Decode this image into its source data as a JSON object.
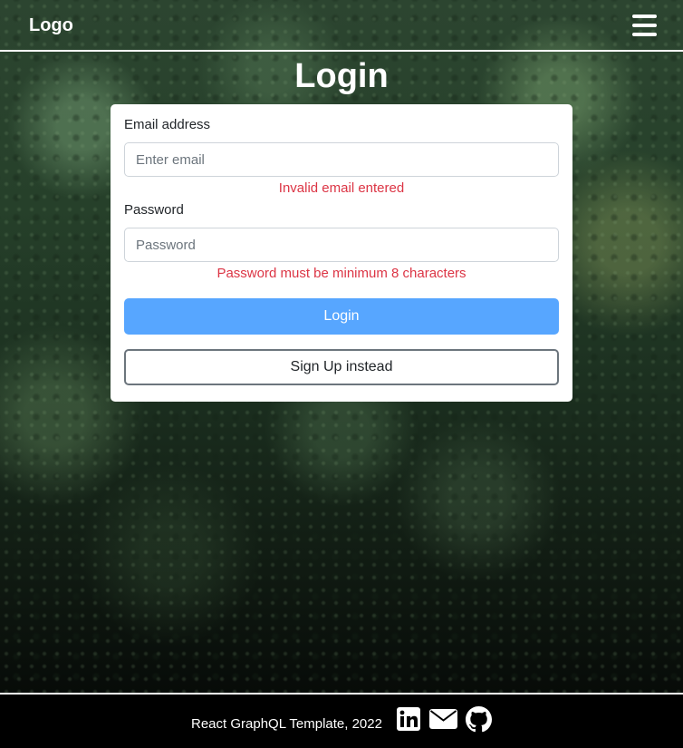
{
  "navbar": {
    "logo": "Logo",
    "menu_icon": "hamburger-menu-icon"
  },
  "page": {
    "title": "Login"
  },
  "form": {
    "email_label": "Email address",
    "email_placeholder": "Enter email",
    "email_value": "",
    "email_error": "Invalid email entered",
    "password_label": "Password",
    "password_placeholder": "Password",
    "password_value": "",
    "password_error": "Password must be minimum 8 characters",
    "login_button": "Login",
    "signup_button": "Sign Up instead"
  },
  "footer": {
    "text": "React GraphQL Template, 2022",
    "icons": [
      "linkedin-icon",
      "envelope-icon",
      "github-icon"
    ]
  },
  "colors": {
    "primary_button": "#57a6ff",
    "error": "#dc3545",
    "footer_bg": "#000000",
    "text_light": "#ffffff"
  }
}
